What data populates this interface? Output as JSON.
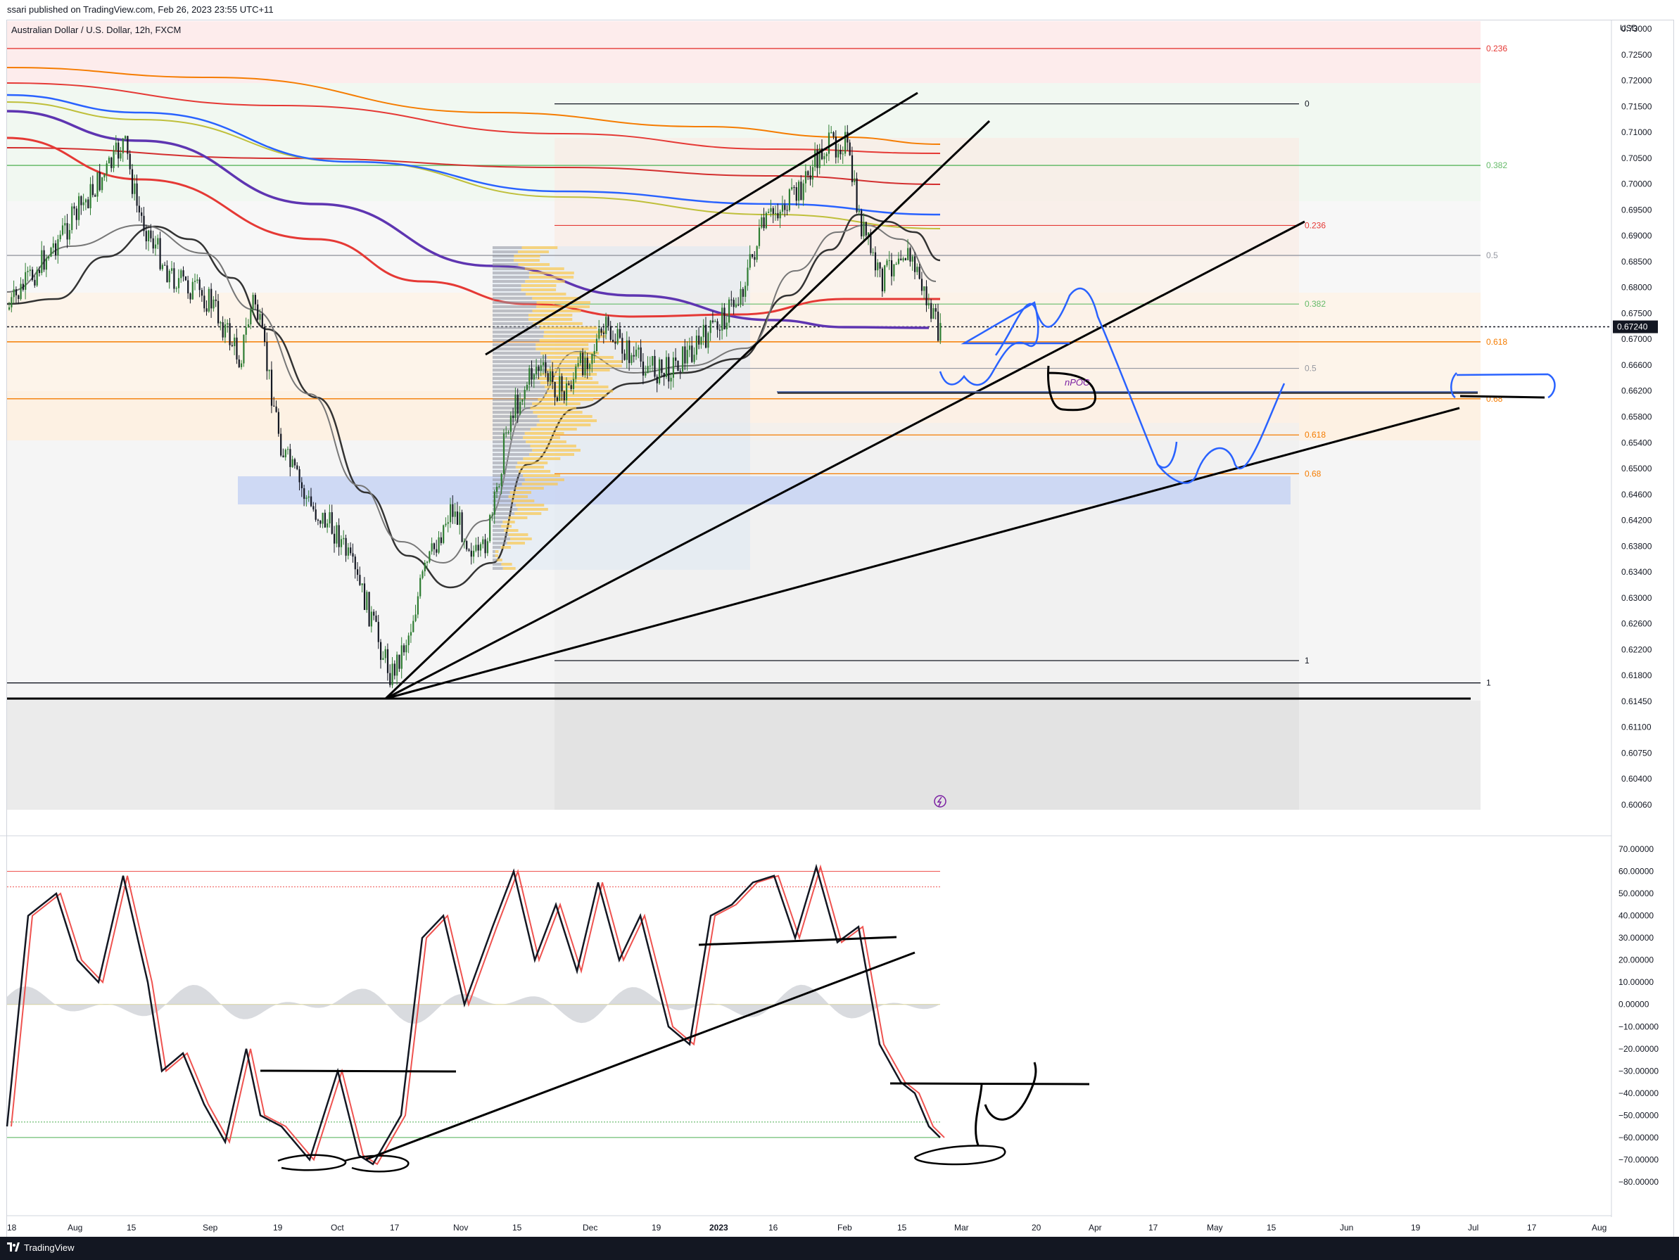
{
  "header": {
    "published": "ssari published on TradingView.com, Feb 26, 2023 23:55 UTC+11",
    "symbol": "Australian Dollar / U.S. Dollar, 12h, FXCM",
    "currency": "USD"
  },
  "footer": {
    "brand": "TradingView"
  },
  "chart_data": [
    {
      "type": "candlestick",
      "ylim": [
        0.6006,
        0.732
      ],
      "price_ticks": [
        "0.73000",
        "0.72500",
        "0.72000",
        "0.71500",
        "0.71000",
        "0.70500",
        "0.70000",
        "0.69500",
        "0.69000",
        "0.68500",
        "0.68000",
        "0.67500",
        "0.67000",
        "0.66600",
        "0.66200",
        "0.65800",
        "0.65400",
        "0.65000",
        "0.64600",
        "0.64200",
        "0.63800",
        "0.63400",
        "0.63000",
        "0.62600",
        "0.62200",
        "0.61800",
        "0.61450",
        "0.61100",
        "0.60750",
        "0.60400",
        "0.60060"
      ],
      "last_price": "0.67240",
      "time_ticks": [
        "18",
        "Aug",
        "15",
        "Sep",
        "19",
        "Oct",
        "17",
        "Nov",
        "15",
        "Dec",
        "19",
        "2023",
        "16",
        "Feb",
        "15",
        "Mar",
        "20",
        "Apr",
        "17",
        "May",
        "15",
        "Jun",
        "19",
        "Jul",
        "17",
        "Aug"
      ],
      "fib_outer": [
        {
          "label": "0.236",
          "price": 0.7262,
          "color": "#e53935"
        },
        {
          "label": "0.382",
          "price": 0.7036,
          "color": "#66bb6a"
        },
        {
          "label": "0.5",
          "price": 0.6862,
          "color": "#9598a1"
        },
        {
          "label": "0.618",
          "price": 0.6696,
          "color": "#f57c00"
        },
        {
          "label": "0.68",
          "price": 0.6608,
          "color": "#f57c00"
        },
        {
          "label": "1",
          "price": 0.617,
          "color": "#131722"
        }
      ],
      "fib_inner": [
        {
          "label": "0",
          "price": 0.7155,
          "color": "#131722"
        },
        {
          "label": "0.236",
          "price": 0.692,
          "color": "#e53935"
        },
        {
          "label": "0.382",
          "price": 0.6768,
          "color": "#66bb6a"
        },
        {
          "label": "0.5",
          "price": 0.6655,
          "color": "#9598a1"
        },
        {
          "label": "0.618",
          "price": 0.6552,
          "color": "#f57c00"
        },
        {
          "label": "0.68",
          "price": 0.6492,
          "color": "#f57c00"
        },
        {
          "label": "1",
          "price": 0.6203,
          "color": "#131722"
        }
      ],
      "annotations": [
        "nPOC"
      ],
      "colors": {
        "up": "#2e7d32",
        "down": "#131722",
        "fib_red": "#e53935",
        "fib_green": "#66bb6a",
        "fib_orange": "#f57c00",
        "projection": "#2962ff",
        "volume_profile": "#f9c74f"
      }
    },
    {
      "type": "line",
      "ylim": [
        -85,
        75
      ],
      "ticks": [
        "70.00000",
        "60.00000",
        "50.00000",
        "40.00000",
        "30.00000",
        "20.00000",
        "10.00000",
        "0.00000",
        "−10.00000",
        "−20.00000",
        "−30.00000",
        "−40.00000",
        "−50.00000",
        "−60.00000",
        "−70.00000",
        "−80.00000"
      ],
      "levels": [
        60,
        53,
        0,
        -53,
        -60
      ],
      "colors": {
        "k": "#131722",
        "d": "#ef5350",
        "histogram": "#c0c3c9"
      }
    }
  ]
}
